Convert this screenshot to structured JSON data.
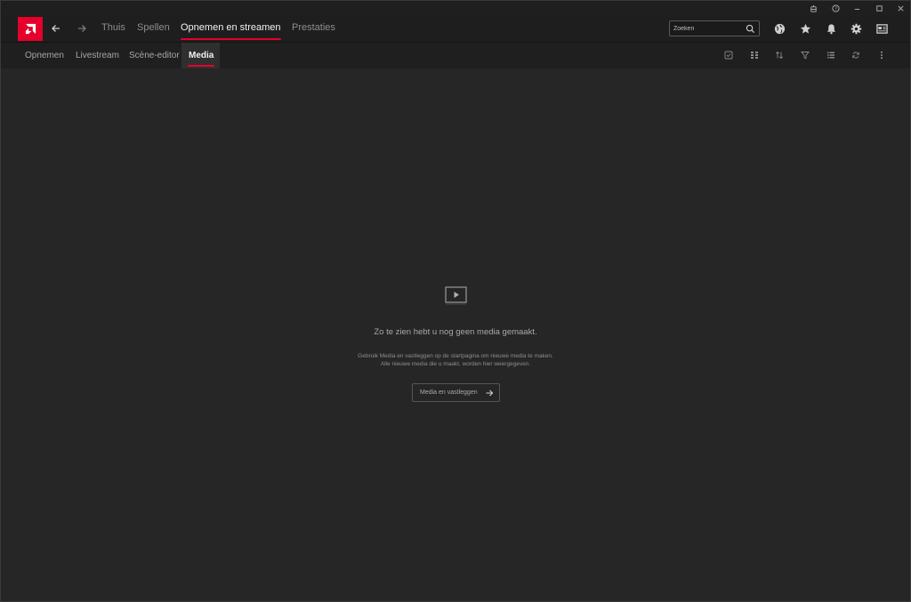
{
  "window_controls": {
    "icons": [
      "bug-report-icon",
      "help-icon",
      "minimize-icon",
      "maximize-icon",
      "close-icon"
    ]
  },
  "topbar": {
    "logo_icon": "amd-logo-icon",
    "tabs": [
      {
        "label": "Thuis",
        "active": false
      },
      {
        "label": "Spellen",
        "active": false
      },
      {
        "label": "Opnemen en streamen",
        "active": true
      },
      {
        "label": "Prestaties",
        "active": false
      }
    ],
    "search": {
      "placeholder": "Zoeken",
      "value": ""
    },
    "icons": [
      "globe-icon",
      "star-icon",
      "bell-icon",
      "gear-icon",
      "layout-icon"
    ]
  },
  "subbar": {
    "tabs": [
      {
        "label": "Opnemen",
        "active": false
      },
      {
        "label": "Livestream",
        "active": false
      },
      {
        "label": "Scène-editor",
        "active": false
      },
      {
        "label": "Media",
        "active": true
      }
    ],
    "icons": [
      "select-checkbox-icon",
      "grid-view-icon",
      "sort-icon",
      "filter-icon",
      "list-view-icon",
      "refresh-icon",
      "more-vertical-icon"
    ]
  },
  "empty_state": {
    "icon": "media-play-icon",
    "title": "Zo te zien hebt u nog geen media gemaakt.",
    "description_line1": "Gebruik Media en vastleggen op de startpagina om nieuwe media te maken.",
    "description_line2": "Alle nieuwe media die u maakt, worden hier weergegeven.",
    "button_label": "Media en vastleggen"
  },
  "colors": {
    "accent": "#e4002b",
    "background": "#262626",
    "bar": "#1e1e1e"
  }
}
